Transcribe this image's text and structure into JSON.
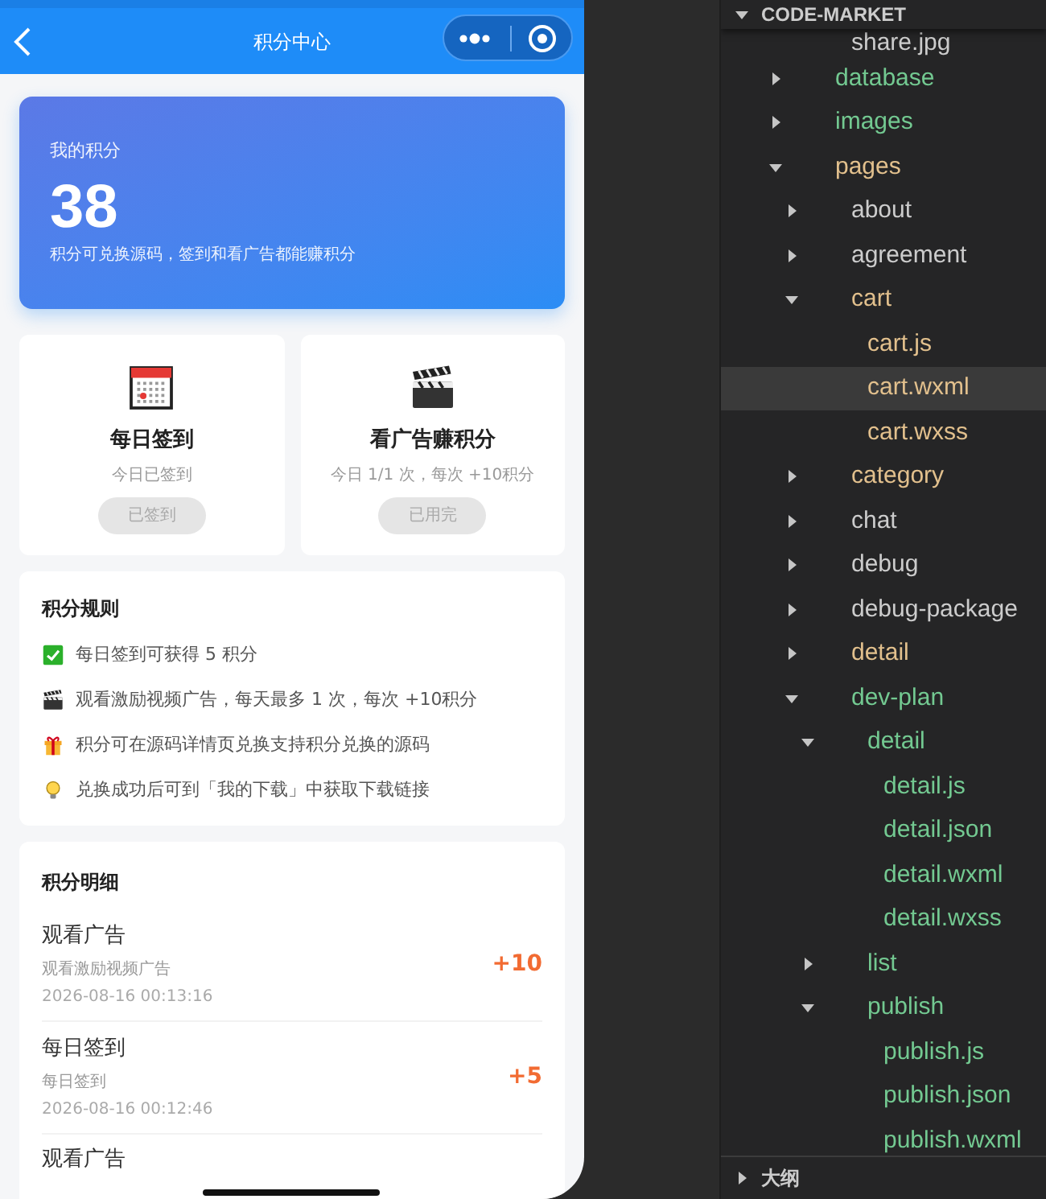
{
  "phone": {
    "nav": {
      "title": "积分中心"
    },
    "points_card": {
      "label": "我的积分",
      "value": "38",
      "hint": "积分可兑换源码，签到和看广告都能赚积分"
    },
    "tasks": [
      {
        "kind": "calendar",
        "title": "每日签到",
        "subtitle": "今日已签到",
        "button": "已签到",
        "disabled": true
      },
      {
        "kind": "clapper",
        "title": "看广告赚积分",
        "subtitle": "今日 1/1 次，每次 +10积分",
        "button": "已用完",
        "disabled": true
      }
    ],
    "rules": {
      "title": "积分规则",
      "items": [
        {
          "kind": "check",
          "text": "每日签到可获得 5 积分"
        },
        {
          "kind": "clapper",
          "text": "观看激励视频广告，每天最多 1 次，每次 +10积分"
        },
        {
          "kind": "gift",
          "text": "积分可在源码详情页兑换支持积分兑换的源码"
        },
        {
          "kind": "bulb",
          "text": "兑换成功后可到「我的下载」中获取下载链接"
        }
      ]
    },
    "records": {
      "title": "积分明细",
      "items": [
        {
          "title": "观看广告",
          "desc": "观看激励视频广告",
          "time": "2026-08-16 00:13:16",
          "amount": "+10"
        },
        {
          "title": "每日签到",
          "desc": "每日签到",
          "time": "2026-08-16 00:12:46",
          "amount": "+5"
        },
        {
          "title": "观看广告"
        }
      ]
    }
  },
  "explorer": {
    "title": "CODE-MARKET",
    "expanded": true,
    "scrolled_item": {
      "label": "share.jpg",
      "color": "#cccccc"
    },
    "tree": [
      {
        "label": "database",
        "kind": "folder",
        "expanded": false,
        "selected": false,
        "color": "#73c991"
      },
      {
        "label": "images",
        "kind": "folder",
        "expanded": false,
        "selected": false,
        "color": "#73c991"
      },
      {
        "label": "pages",
        "kind": "folder",
        "expanded": true,
        "selected": false,
        "color": "#e2c08d",
        "children": [
          {
            "label": "about",
            "kind": "folder",
            "expanded": false,
            "selected": false,
            "color": "#cccccc"
          },
          {
            "label": "agreement",
            "kind": "folder",
            "expanded": false,
            "selected": false,
            "color": "#cccccc"
          },
          {
            "label": "cart",
            "kind": "folder",
            "expanded": true,
            "selected": false,
            "color": "#e2c08d",
            "children": [
              {
                "label": "cart.js",
                "kind": "file",
                "selected": false,
                "color": "#e2c08d"
              },
              {
                "label": "cart.wxml",
                "kind": "file",
                "selected": true,
                "color": "#e2c08d"
              },
              {
                "label": "cart.wxss",
                "kind": "file",
                "selected": false,
                "color": "#e2c08d"
              }
            ]
          },
          {
            "label": "category",
            "kind": "folder",
            "expanded": false,
            "selected": false,
            "color": "#e2c08d"
          },
          {
            "label": "chat",
            "kind": "folder",
            "expanded": false,
            "selected": false,
            "color": "#cccccc"
          },
          {
            "label": "debug",
            "kind": "folder",
            "expanded": false,
            "selected": false,
            "color": "#cccccc"
          },
          {
            "label": "debug-package",
            "kind": "folder",
            "expanded": false,
            "selected": false,
            "color": "#cccccc"
          },
          {
            "label": "detail",
            "kind": "folder",
            "expanded": false,
            "selected": false,
            "color": "#e2c08d"
          },
          {
            "label": "dev-plan",
            "kind": "folder",
            "expanded": true,
            "selected": false,
            "color": "#73c991",
            "children": [
              {
                "label": "detail",
                "kind": "folder",
                "expanded": true,
                "selected": false,
                "color": "#73c991",
                "children": [
                  {
                    "label": "detail.js",
                    "kind": "file",
                    "selected": false,
                    "color": "#73c991"
                  },
                  {
                    "label": "detail.json",
                    "kind": "file",
                    "selected": false,
                    "color": "#73c991"
                  },
                  {
                    "label": "detail.wxml",
                    "kind": "file",
                    "selected": false,
                    "color": "#73c991"
                  },
                  {
                    "label": "detail.wxss",
                    "kind": "file",
                    "selected": false,
                    "color": "#73c991"
                  }
                ]
              },
              {
                "label": "list",
                "kind": "folder",
                "expanded": false,
                "selected": false,
                "color": "#73c991"
              },
              {
                "label": "publish",
                "kind": "folder",
                "expanded": true,
                "selected": false,
                "color": "#73c991",
                "children": [
                  {
                    "label": "publish.js",
                    "kind": "file",
                    "selected": false,
                    "color": "#73c991"
                  },
                  {
                    "label": "publish.json",
                    "kind": "file",
                    "selected": false,
                    "color": "#73c991"
                  },
                  {
                    "label": "publish.wxml",
                    "kind": "file",
                    "selected": false,
                    "color": "#73c991"
                  }
                ]
              }
            ]
          }
        ]
      }
    ],
    "outline": {
      "title": "大纲",
      "expanded": false
    }
  }
}
